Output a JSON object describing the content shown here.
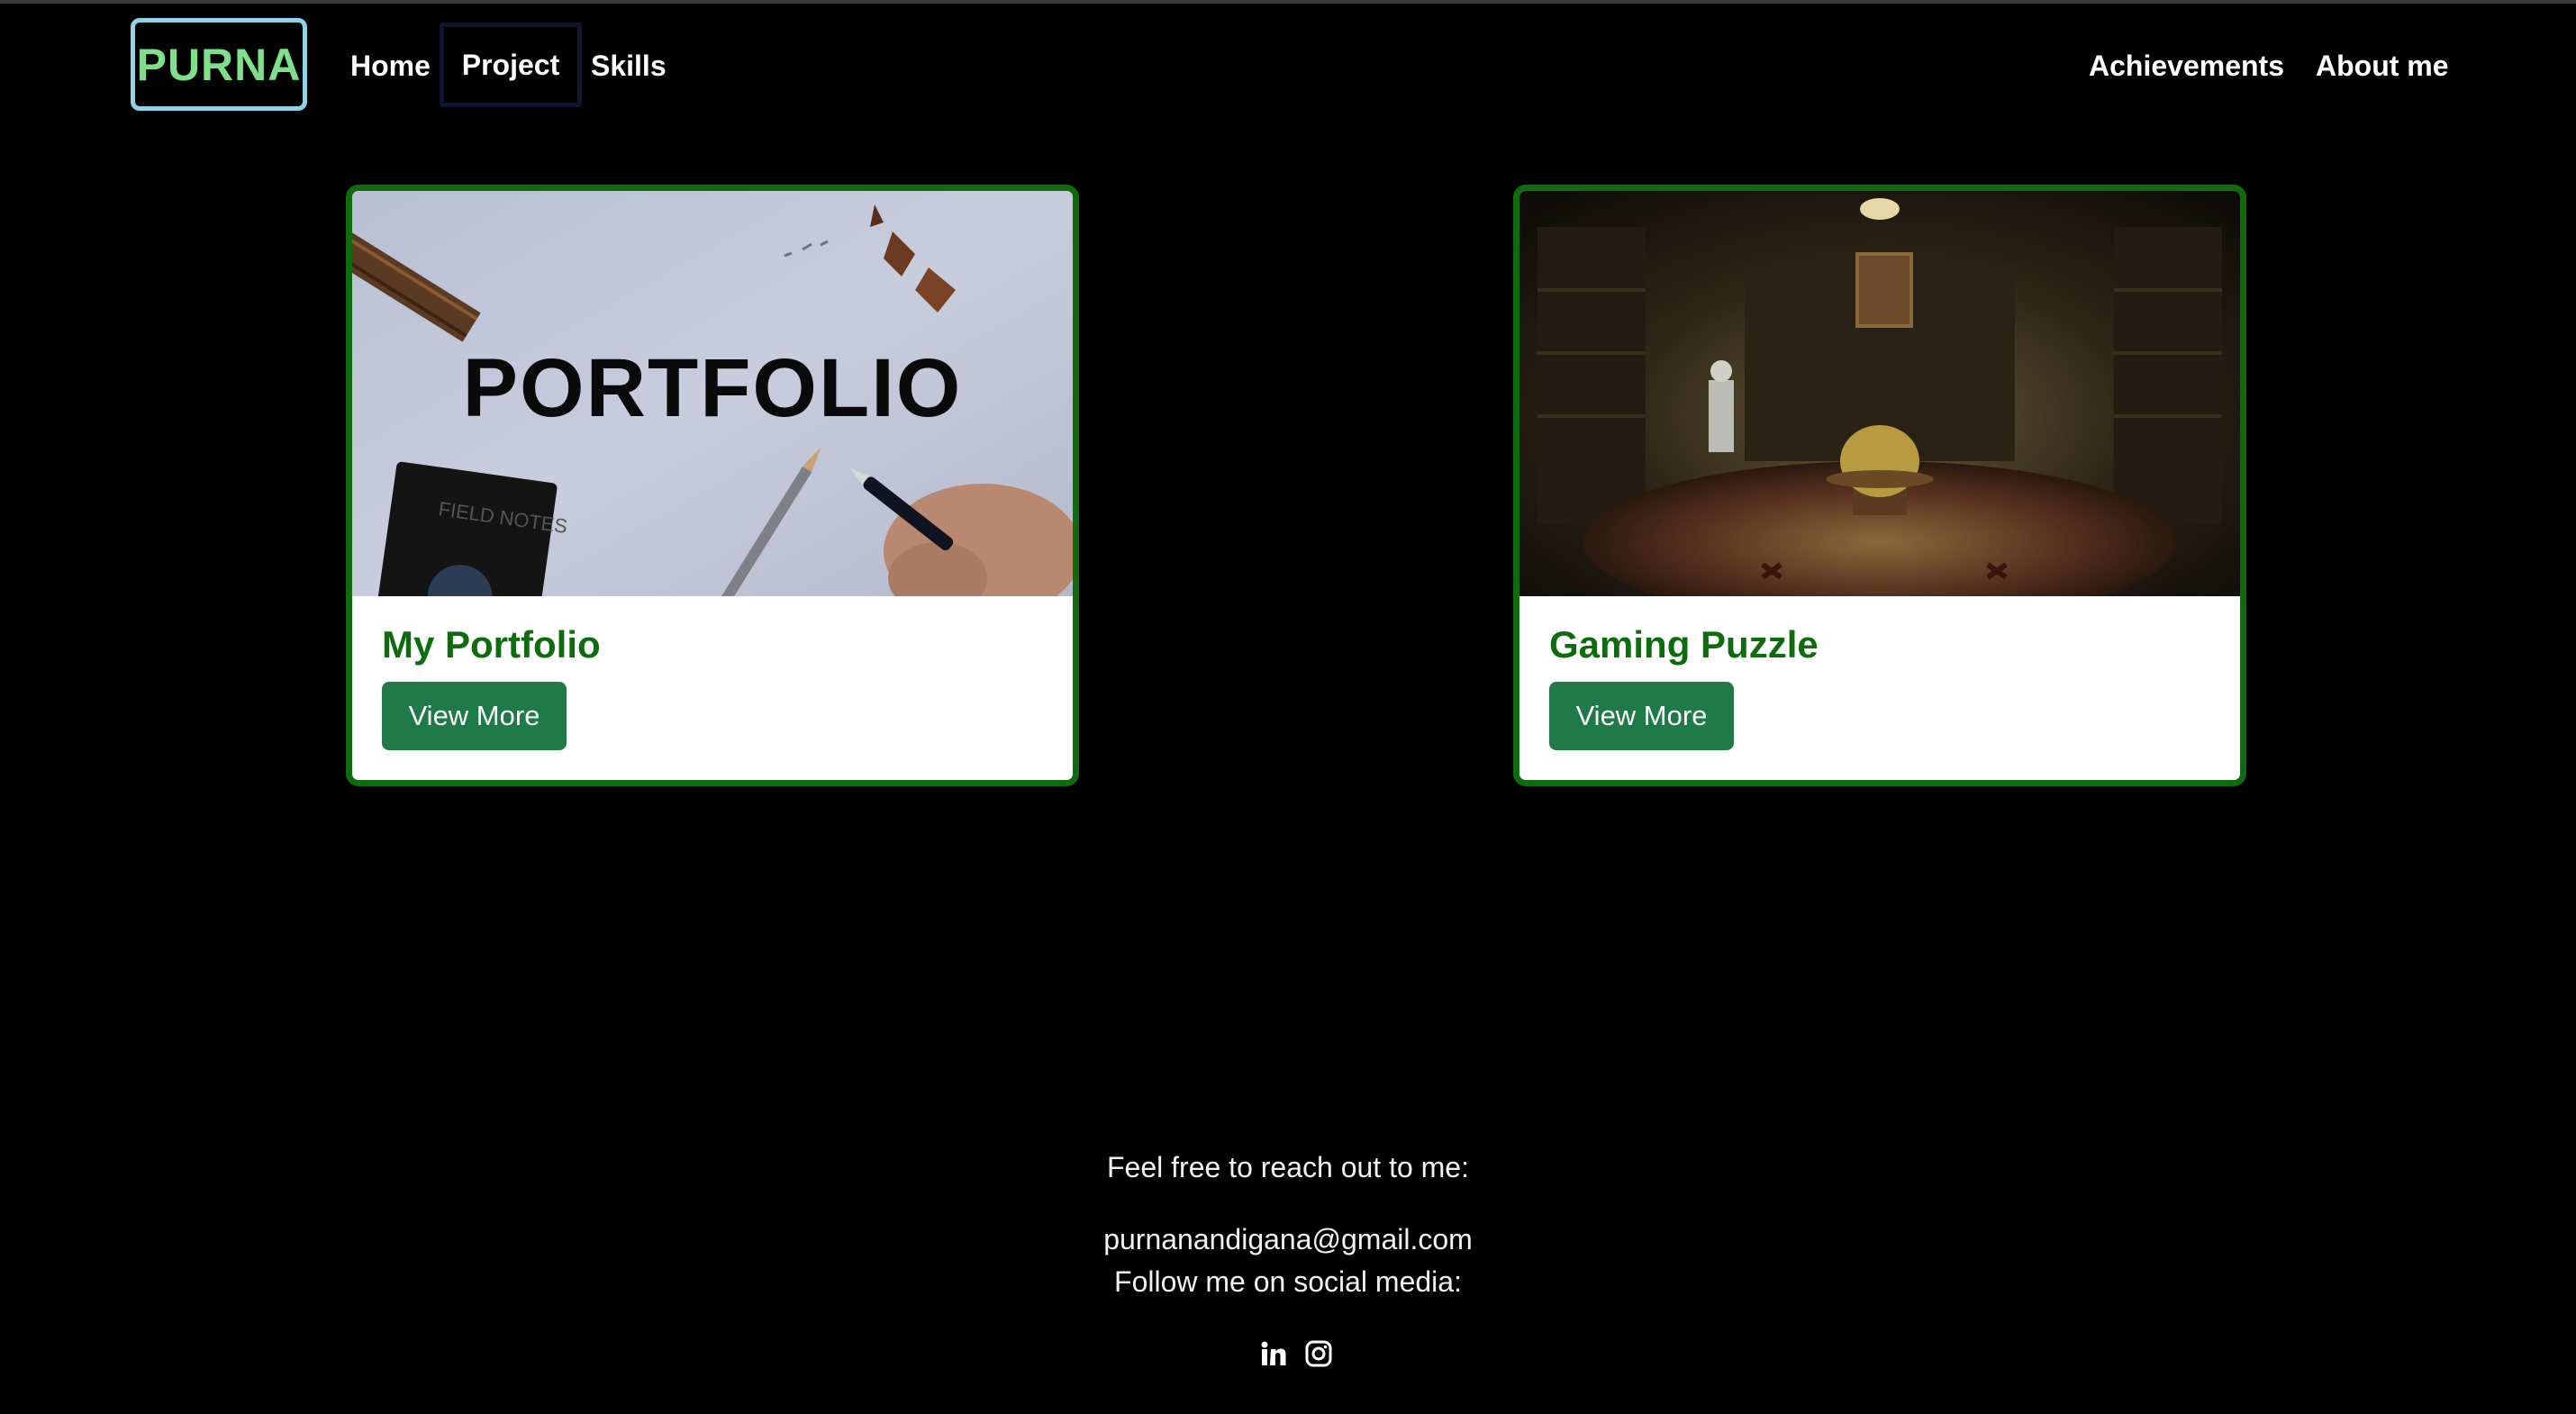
{
  "nav": {
    "brand": "PURNA",
    "home": "Home",
    "project": "Project",
    "skills": "Skills",
    "achievements": "Achievements",
    "about": "About me"
  },
  "projects": [
    {
      "image_text": "PORTFOLIO",
      "notebook_text": "FIELD NOTES",
      "title": "My Portfolio",
      "button": "View More"
    },
    {
      "title": "Gaming Puzzle",
      "button": "View More"
    }
  ],
  "footer": {
    "reach_out": "Feel free to reach out to me:",
    "email": "purnanandigana@gmail.com",
    "follow": "Follow me on social media:",
    "social_icons": [
      "linkedin-icon",
      "instagram-icon"
    ]
  },
  "colors": {
    "accent_green": "#0e6b0e",
    "button_green": "#1e7a46",
    "brand_text": "#7fe08a",
    "brand_border": "#8fd3e8"
  }
}
